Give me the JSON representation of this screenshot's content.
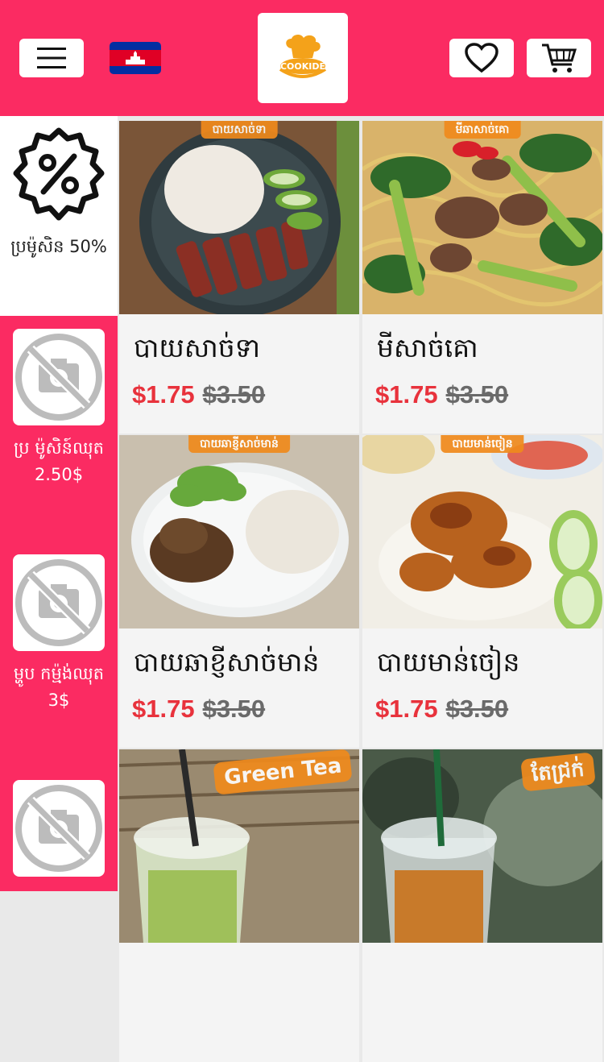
{
  "header": {
    "menu_icon": "hamburger-icon",
    "flag_icon": "cambodia-flag-icon",
    "logo_text": "COOKIDE",
    "favorite_icon": "heart-icon",
    "cart_icon": "shopping-cart-icon",
    "brand_color": "#fb2b62"
  },
  "sidebar": {
    "items": [
      {
        "label": "ប្រម៉ូសិន 50%",
        "icon": "percent-badge-icon",
        "active": true
      },
      {
        "label": "ប្រ ម៉ូសិន៍ឈុត 2.50$",
        "icon": "no-image-icon",
        "active": false
      },
      {
        "label": "ម្ហូប កម្ម៉ង់ឈុត 3$",
        "icon": "no-image-icon",
        "active": false
      },
      {
        "label": "",
        "icon": "no-image-icon",
        "active": false
      }
    ]
  },
  "products": [
    {
      "badge": "បាយសាច់ទា",
      "name": "បាយសាច់ទា",
      "price": "$1.75",
      "old_price": "$3.50"
    },
    {
      "badge": "មីឆាសាច់គោ",
      "name": "មីសាច់គោ",
      "price": "$1.75",
      "old_price": "$3.50"
    },
    {
      "badge": "បាយឆាខ្ញីសាច់មាន់",
      "name": "បាយឆាខ្ញីសាច់មាន់",
      "price": "$1.75",
      "old_price": "$3.50"
    },
    {
      "badge": "បាយមាន់ចៀន",
      "name": "បាយមាន់ចៀន",
      "price": "$1.75",
      "old_price": "$3.50"
    },
    {
      "badge": "Green Tea",
      "name": "",
      "price": "",
      "old_price": ""
    },
    {
      "badge": "តែជ្រក់",
      "name": "",
      "price": "",
      "old_price": ""
    }
  ]
}
